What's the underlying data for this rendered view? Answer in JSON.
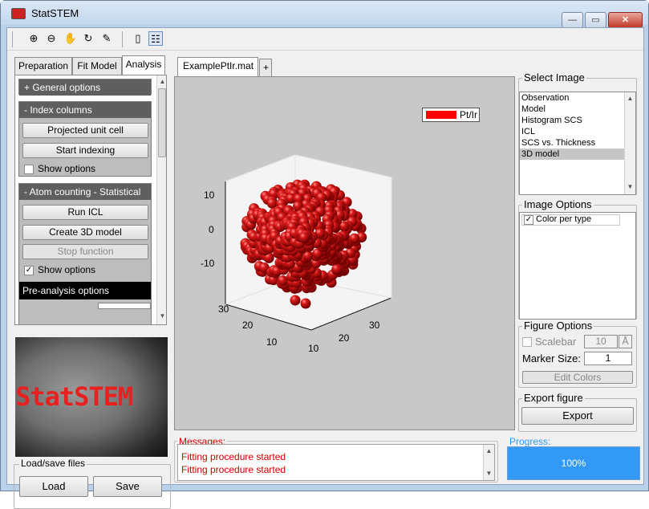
{
  "window": {
    "title": "StatSTEM",
    "min_label": "—",
    "max_label": "▭",
    "close_label": "✕"
  },
  "toolbar": {
    "icons": [
      "zoom-in-icon",
      "zoom-out-icon",
      "pan-hand-icon",
      "rotate-3d-icon",
      "data-cursor-icon",
      "colorbar-icon",
      "legend-icon"
    ],
    "glyphs": [
      "⊕",
      "⊖",
      "✋",
      "↻",
      "✎",
      "▯",
      "☷"
    ]
  },
  "left_tabs": [
    "Preparation",
    "Fit Model",
    "Analysis"
  ],
  "panel": {
    "general_options": "+ General options",
    "index_columns": "- Index columns",
    "projected_unit_cell": "Projected unit cell",
    "start_indexing": "Start indexing",
    "show_options_1": "Show options",
    "atom_counting": "- Atom counting - Statistical",
    "run_icl": "Run ICL",
    "create_3d_model": "Create 3D model",
    "stop_function": "Stop function",
    "show_options_2": "Show options",
    "pre_analysis": "Pre-analysis options",
    "check": "✓"
  },
  "logo": {
    "text": "StatSTEM"
  },
  "load_save": {
    "title": "Load/save files",
    "load": "Load",
    "save": "Save"
  },
  "figure_tabs": {
    "file": "ExamplePtIr.mat",
    "add": "+"
  },
  "plot": {
    "legend": "Pt/Ir",
    "z_ticks": [
      "10",
      "0",
      "-10"
    ],
    "x_ticks": [
      "10",
      "20",
      "30"
    ],
    "y_ticks": [
      "30",
      "20",
      "10"
    ]
  },
  "select_image": {
    "title": "Select Image",
    "items": [
      "Observation",
      "Model",
      "Histogram SCS",
      "ICL",
      "SCS vs. Thickness",
      "3D model"
    ],
    "selected": "3D model"
  },
  "image_options": {
    "title": "Image Options",
    "color_per_type": "Color per type",
    "check": "✓"
  },
  "figure_options": {
    "title": "Figure Options",
    "scalebar": "Scalebar",
    "scalebar_value": "10",
    "scalebar_unit": "Å",
    "marker_size_label": "Marker Size:",
    "marker_size_value": "1",
    "edit_colors": "Edit Colors"
  },
  "export_figure": {
    "title": "Export figure",
    "export": "Export"
  },
  "messages": {
    "title": "Messages:",
    "lines": [
      "Fitting procedure started",
      "Fitting procedure started"
    ]
  },
  "progress": {
    "title": "Progress:",
    "value": "100%"
  },
  "colors": {
    "atom": "#d81818",
    "legend_swatch": "#ff0000",
    "progress": "#3399f7",
    "message_text": "#d00000"
  }
}
